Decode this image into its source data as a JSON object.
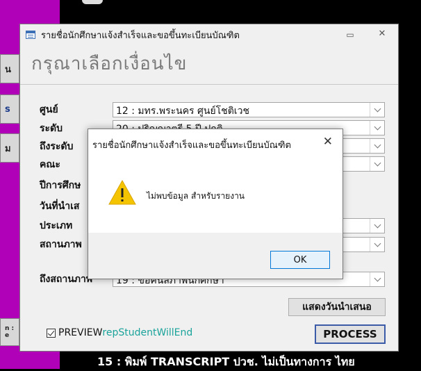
{
  "background": {
    "left_tabs": [
      "น",
      "s",
      "ม",
      "n :",
      "e"
    ],
    "bottom_text": "15 : พิมพ์ TRANSCRIPT ปวช. ไม่เป็นทางการ ไทย"
  },
  "window": {
    "title": "รายชื่อนักศึกษาแจ้งสำเร็จและขอขึ้นทะเบียนบัณฑิต",
    "min_icon": "minimize-icon",
    "close_icon": "close-icon",
    "prompt": "กรุณาเลือกเงื่อนไข",
    "fields": [
      {
        "label": "ศูนย์",
        "value": "12 : มทร.พระนคร ศูนย์โชติเวช"
      },
      {
        "label": "ระดับ",
        "value": "20 : ปริญญาตรี 5 ปี ปกติ"
      },
      {
        "label": "ถึงระดับ",
        "value": ""
      },
      {
        "label": "คณะ",
        "value": ""
      },
      {
        "label": "ปีการศึกษ",
        "value": null
      },
      {
        "label": "วันที่นำเส",
        "value": null
      },
      {
        "label": "ประเภท",
        "value": ""
      },
      {
        "label": "สถานภาพ",
        "value": ""
      },
      {
        "label": "ถึงสถานภาพ",
        "value": "19 : ขอคืนสภาพนักศึกษา"
      }
    ],
    "show_date_button": "แสดงวันนำเสนอ",
    "preview_label": "PREVIEW",
    "report_name": "repStudentWillEnd",
    "process_button": "PROCESS"
  },
  "dialog": {
    "title": "รายชื่อนักศึกษาแจ้งสำเร็จและขอขึ้นทะเบียนบัณฑิต",
    "close": "✕",
    "message": "ไม่พบข้อมูล สำหรับรายงาน",
    "ok": "OK",
    "icon": "warning-icon"
  },
  "colors": {
    "magenta": "#b000b8",
    "report_name": "#1aa39a",
    "warning": "#f5c400",
    "ok_border": "#0078d7"
  }
}
